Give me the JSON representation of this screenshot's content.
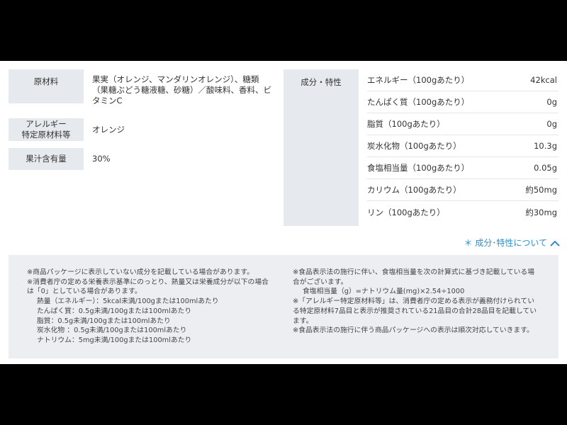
{
  "specs": [
    {
      "label_lines": [
        "原材料"
      ],
      "value": "果実（オレンジ、マンダリンオレンジ）、糖類（果糖ぶどう糖液糖、砂糖）／酸味料、香料、ビタミンC"
    },
    {
      "label_lines": [
        "アレルギー",
        "特定原材料等"
      ],
      "value": "オレンジ"
    },
    {
      "label_lines": [
        "果汁含有量"
      ],
      "value": "30%"
    }
  ],
  "nutrition": {
    "label": "成分・特性",
    "rows": [
      {
        "name": "エネルギー（100gあたり）",
        "value": "42kcal"
      },
      {
        "name": "たんぱく質（100gあたり）",
        "value": "0g"
      },
      {
        "name": "脂質（100gあたり）",
        "value": "0g"
      },
      {
        "name": "炭水化物（100gあたり）",
        "value": "10.3g"
      },
      {
        "name": "食塩相当量（100gあたり）",
        "value": "0.05g"
      },
      {
        "name": "カリウム（100gあたり）",
        "value": "約50mg"
      },
      {
        "name": "リン（100gあたり）",
        "value": "約30mg"
      }
    ]
  },
  "toggle": {
    "label": "＊ 成分･特性について"
  },
  "notes": {
    "left": [
      "※商品パッケージに表示していない成分を記載している場合があります。",
      "※消費者庁の定める栄養表示基準にのっとり、熱量又は栄養成分が以下の場合は「0」としている場合があります。",
      "熱量（エネルギー）：5kcal未満/100gまたは100mlあたり",
      "たんぱく質：0.5g未満/100gまたは100mlあたり",
      "脂質：0.5g未満/100gまたは100mlあたり",
      "炭水化物 ：0.5g未満/100gまたは100mlあたり",
      "ナトリウム：5mg未満/100gまたは100mlあたり"
    ],
    "right": [
      "※食品表示法の施行に伴い、食塩相当量を次の計算式に基づき記載している場合がございます。",
      "食塩相当量（g）=ナトリウム量(mg)×2.54÷1000",
      "※「アレルギー特定原材料等」は、消費者庁の定める表示が義務付けられている特定原材料7品目と表示が推奨されている21品目の合計28品目を記載しています。",
      "※食品表示法の施行に伴う商品パッケージへの表示は順次対応していきます。"
    ]
  }
}
